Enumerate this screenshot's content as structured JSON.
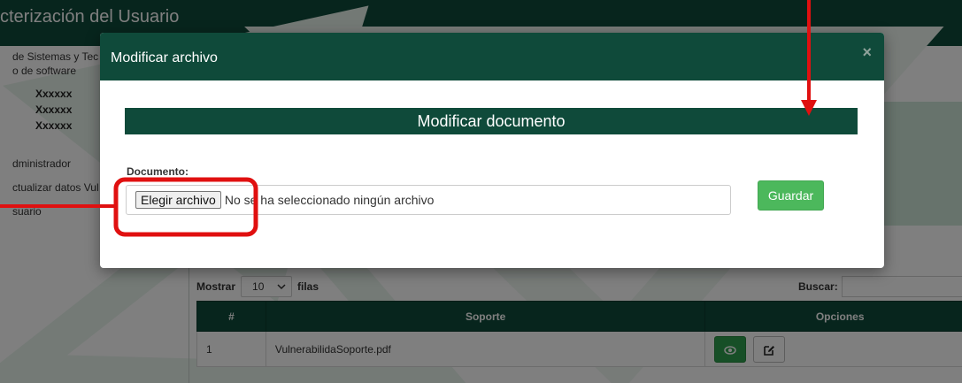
{
  "background": {
    "header_title": "cterización del Usuario",
    "org_lines": [
      "de Sistemas y Tec",
      "o de software"
    ],
    "users": [
      "Xxxxxx",
      "Xxxxxx",
      "Xxxxxx"
    ],
    "nav_items": [
      "dministrador",
      "ctualizar datos Vul",
      "suario"
    ],
    "table_controls": {
      "show_label": "Mostrar",
      "show_value": "10",
      "rows_label": "filas",
      "search_label": "Buscar:"
    },
    "table": {
      "headers": [
        "#",
        "Soporte",
        "Opciones"
      ],
      "rows": [
        {
          "num": "1",
          "file": "VulnerabilidaSoporte.pdf"
        }
      ]
    }
  },
  "modal": {
    "title": "Modificar archivo",
    "close_symbol": "×",
    "section_heading": "Modificar documento",
    "document_label": "Documento:",
    "file_button_label": "Elegir archivo",
    "file_status": "No se ha seleccionado ningún archivo",
    "save_label": "Guardar"
  },
  "icons": {
    "view": "eye-icon",
    "edit": "edit-icon",
    "select_caret": "chevron-down-icon"
  },
  "colors": {
    "primary_dark_green": "#0f4a3a",
    "save_green": "#4cb85c",
    "view_green": "#2e9e4e",
    "annotation_red": "#e01010"
  }
}
